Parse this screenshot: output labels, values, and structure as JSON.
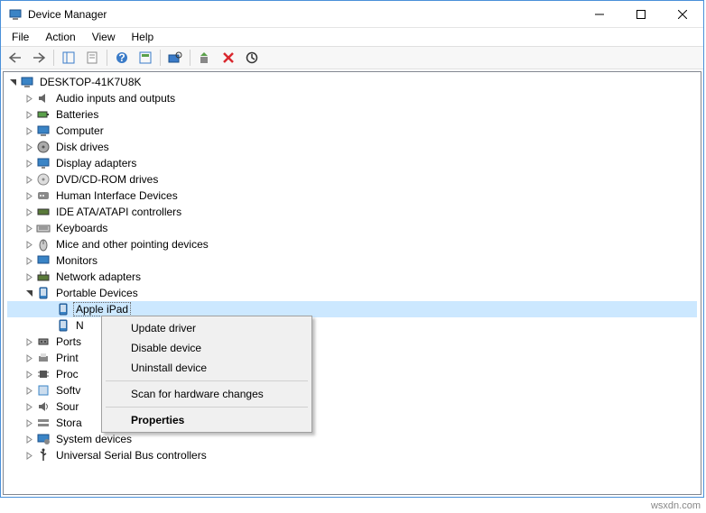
{
  "window": {
    "title": "Device Manager"
  },
  "menu": {
    "file": "File",
    "action": "Action",
    "view": "View",
    "help": "Help"
  },
  "tree": {
    "root": "DESKTOP-41K7U8K",
    "items": [
      {
        "label": "Audio inputs and outputs",
        "icon": "speaker"
      },
      {
        "label": "Batteries",
        "icon": "battery"
      },
      {
        "label": "Computer",
        "icon": "computer"
      },
      {
        "label": "Disk drives",
        "icon": "disk"
      },
      {
        "label": "Display adapters",
        "icon": "display"
      },
      {
        "label": "DVD/CD-ROM drives",
        "icon": "cd"
      },
      {
        "label": "Human Interface Devices",
        "icon": "hid"
      },
      {
        "label": "IDE ATA/ATAPI controllers",
        "icon": "ide"
      },
      {
        "label": "Keyboards",
        "icon": "keyboard"
      },
      {
        "label": "Mice and other pointing devices",
        "icon": "mouse"
      },
      {
        "label": "Monitors",
        "icon": "monitor"
      },
      {
        "label": "Network adapters",
        "icon": "network"
      },
      {
        "label": "Portable Devices",
        "icon": "portable",
        "expanded": true,
        "children": [
          {
            "label": "Apple iPad",
            "icon": "portable",
            "selected": true
          },
          {
            "label": "N",
            "icon": "portable"
          }
        ]
      },
      {
        "label": "Ports",
        "icon": "port"
      },
      {
        "label": "Print",
        "icon": "printer"
      },
      {
        "label": "Proc",
        "icon": "cpu"
      },
      {
        "label": "Softv",
        "icon": "software"
      },
      {
        "label": "Sour",
        "icon": "sound"
      },
      {
        "label": "Stora",
        "icon": "storage"
      },
      {
        "label": "System devices",
        "icon": "system"
      },
      {
        "label": "Universal Serial Bus controllers",
        "icon": "usb"
      }
    ]
  },
  "context_menu": {
    "update": "Update driver",
    "disable": "Disable device",
    "uninstall": "Uninstall device",
    "scan": "Scan for hardware changes",
    "properties": "Properties"
  },
  "watermark": "wsxdn.com"
}
